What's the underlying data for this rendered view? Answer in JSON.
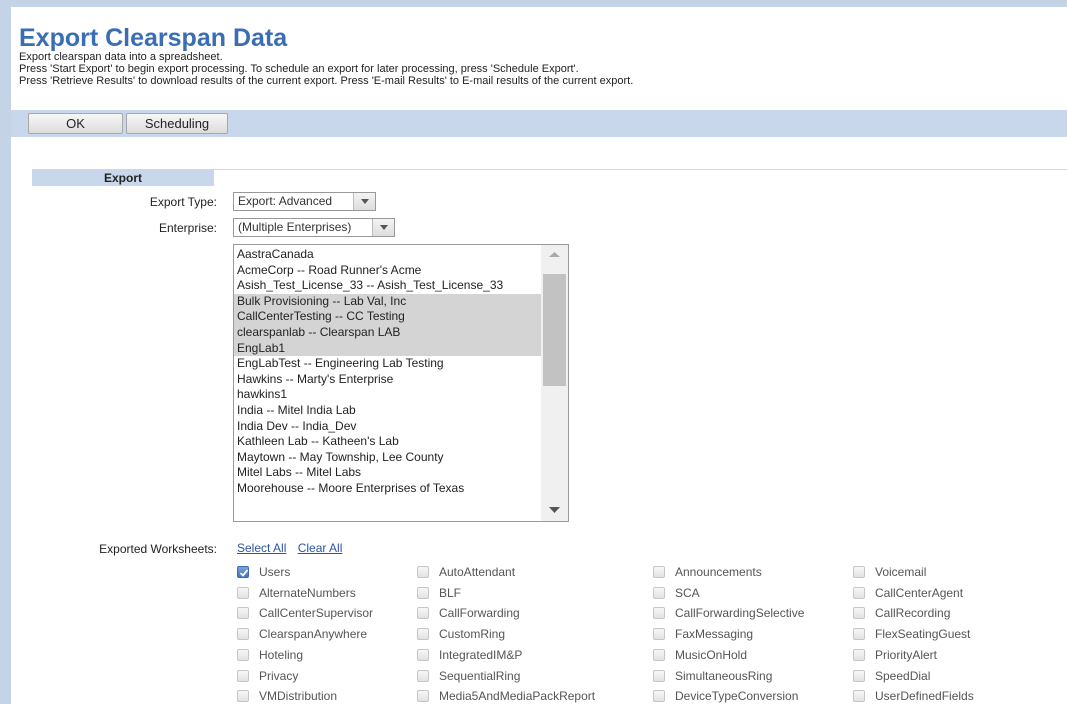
{
  "page": {
    "title": "Export Clearspan Data",
    "desc1": "Export clearspan data into a spreadsheet.",
    "desc2": "Press 'Start Export' to begin export processing.  To schedule an export for later processing, press 'Schedule Export'.",
    "desc3": "Press 'Retrieve Results' to download results of the current export.  Press 'E-mail Results' to E-mail results of the current export."
  },
  "toolbar": {
    "ok_label": "OK",
    "scheduling_label": "Scheduling"
  },
  "section": {
    "title": "Export"
  },
  "form": {
    "export_type_label": "Export Type:",
    "export_type_value": "Export: Advanced",
    "enterprise_label": "Enterprise:",
    "enterprise_value": "(Multiple Enterprises)",
    "worksheets_label": "Exported Worksheets:",
    "select_all": "Select All",
    "clear_all": "Clear All"
  },
  "enterprises": [
    {
      "label": "AastraCanada",
      "selected": false
    },
    {
      "label": "AcmeCorp -- Road Runner's Acme",
      "selected": false
    },
    {
      "label": "Asish_Test_License_33 -- Asish_Test_License_33",
      "selected": false
    },
    {
      "label": "Bulk Provisioning -- Lab Val, Inc",
      "selected": true
    },
    {
      "label": "CallCenterTesting -- CC Testing",
      "selected": true
    },
    {
      "label": "clearspanlab -- Clearspan LAB",
      "selected": true
    },
    {
      "label": "EngLab1",
      "selected": true
    },
    {
      "label": "EngLabTest -- Engineering Lab Testing",
      "selected": false
    },
    {
      "label": "Hawkins -- Marty's Enterprise",
      "selected": false
    },
    {
      "label": "hawkins1",
      "selected": false
    },
    {
      "label": "India -- Mitel India Lab",
      "selected": false
    },
    {
      "label": "India Dev -- India_Dev",
      "selected": false
    },
    {
      "label": "Kathleen Lab -- Katheen's Lab",
      "selected": false
    },
    {
      "label": "Maytown -- May Township, Lee County",
      "selected": false
    },
    {
      "label": "Mitel Labs -- Mitel Labs",
      "selected": false
    },
    {
      "label": "Moorehouse -- Moore Enterprises of Texas",
      "selected": false
    }
  ],
  "worksheets": [
    [
      {
        "label": "Users",
        "checked": true
      },
      {
        "label": "AutoAttendant",
        "checked": false
      },
      {
        "label": "Announcements",
        "checked": false
      },
      {
        "label": "Voicemail",
        "checked": false
      }
    ],
    [
      {
        "label": "AlternateNumbers",
        "checked": false
      },
      {
        "label": "BLF",
        "checked": false
      },
      {
        "label": "SCA",
        "checked": false
      },
      {
        "label": "CallCenterAgent",
        "checked": false
      }
    ],
    [
      {
        "label": "CallCenterSupervisor",
        "checked": false
      },
      {
        "label": "CallForwarding",
        "checked": false
      },
      {
        "label": "CallForwardingSelective",
        "checked": false
      },
      {
        "label": "CallRecording",
        "checked": false
      }
    ],
    [
      {
        "label": "ClearspanAnywhere",
        "checked": false
      },
      {
        "label": "CustomRing",
        "checked": false
      },
      {
        "label": "FaxMessaging",
        "checked": false
      },
      {
        "label": "FlexSeatingGuest",
        "checked": false
      }
    ],
    [
      {
        "label": "Hoteling",
        "checked": false
      },
      {
        "label": "IntegratedIM&P",
        "checked": false
      },
      {
        "label": "MusicOnHold",
        "checked": false
      },
      {
        "label": "PriorityAlert",
        "checked": false
      }
    ],
    [
      {
        "label": "Privacy",
        "checked": false
      },
      {
        "label": "SequentialRing",
        "checked": false
      },
      {
        "label": "SimultaneousRing",
        "checked": false
      },
      {
        "label": "SpeedDial",
        "checked": false
      }
    ],
    [
      {
        "label": "VMDistribution",
        "checked": false
      },
      {
        "label": "Media5AndMediaPackReport",
        "checked": false
      },
      {
        "label": "DeviceTypeConversion",
        "checked": false
      },
      {
        "label": "UserDefinedFields",
        "checked": false
      }
    ]
  ]
}
